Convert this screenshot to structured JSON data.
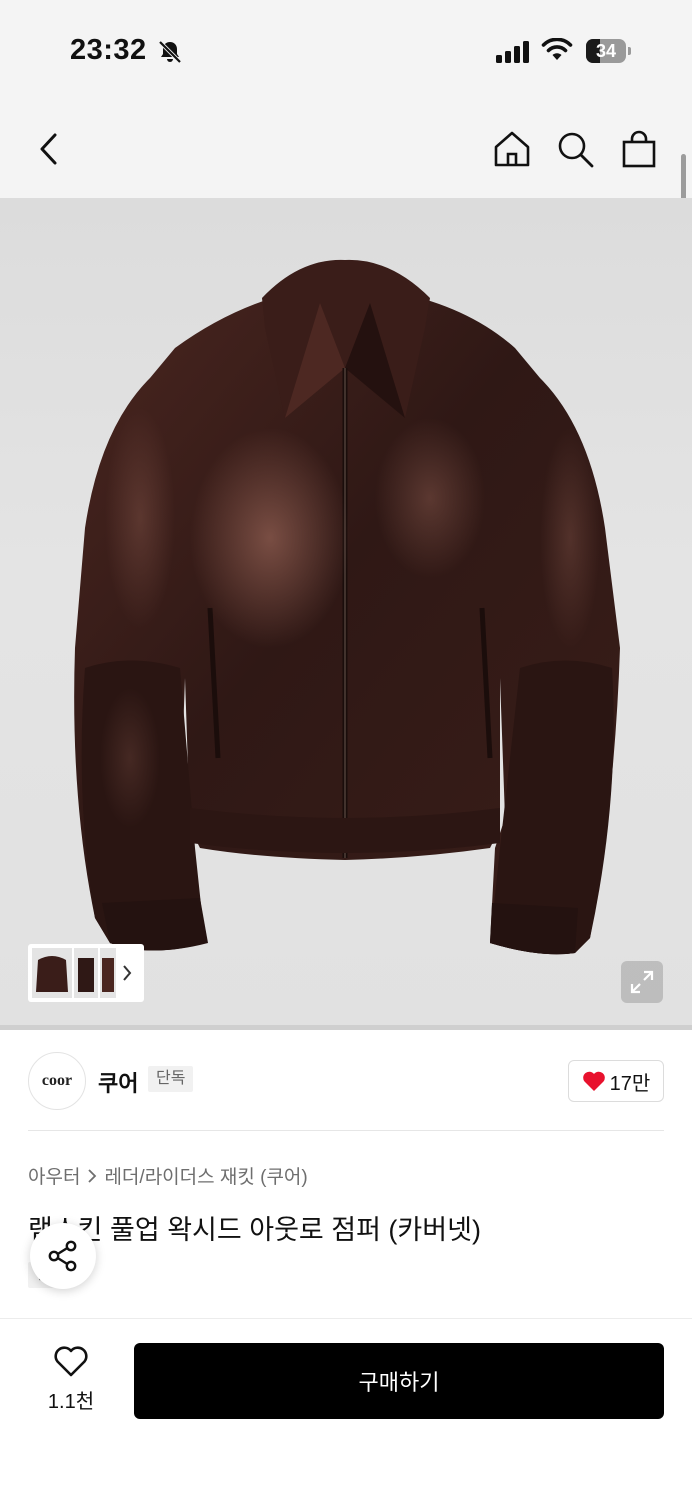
{
  "status": {
    "time": "23:32",
    "battery": "34",
    "battery_level": 0.34
  },
  "nav": {
    "back_icon": "chevron-left-icon",
    "home_icon": "home-icon",
    "search_icon": "search-icon",
    "bag_icon": "shopping-bag-icon"
  },
  "brand": {
    "logo_text": "coor",
    "name": "쿠어",
    "badge": "단독",
    "likes": "17만"
  },
  "breadcrumb": {
    "level1": "아우터",
    "level2": "레더/라이더스 재킷 (쿠어)"
  },
  "product": {
    "title": "램스킨 풀업 왁시드 아웃로 점퍼 (카버넷)",
    "tag": "단독"
  },
  "bottom": {
    "wish_count": "1.1천",
    "buy_label": "구매하기"
  },
  "colors": {
    "accent_heart": "#e8112d",
    "jacket": "#3b1f1a",
    "buy_button": "#000000"
  }
}
